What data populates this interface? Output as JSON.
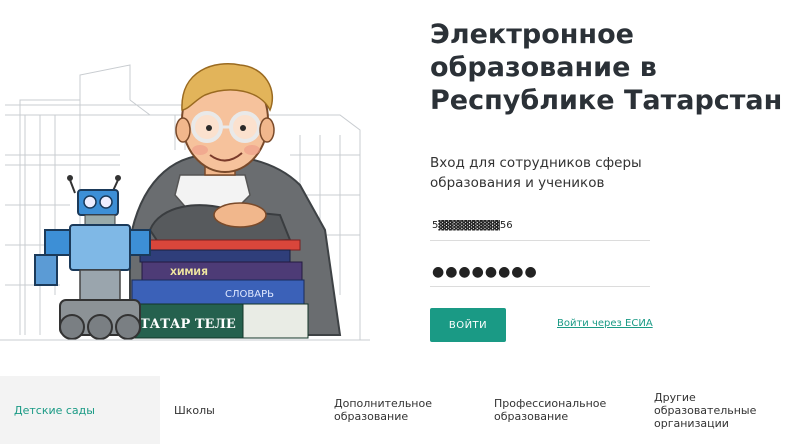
{
  "hero": {
    "title": "Электронное\nобразование в\nРеспублике Татарстан",
    "subtitle": "Вход для сотрудников сферы\nобразования и учеников"
  },
  "illustration": {
    "books": {
      "chemistry": "ХИМИЯ",
      "dictionary": "СЛОВАРЬ",
      "tatar": "ТАТАР ТЕЛЕ"
    }
  },
  "login": {
    "login_value": "5▓▓▓▓▓▓▓▓56",
    "password_value": "●●●●●●●●",
    "submit_label": "ВОЙТИ",
    "esia_link": "Войти через ЕСИА"
  },
  "categories": [
    {
      "label": "Детские сады",
      "active": true
    },
    {
      "label": "Школы",
      "active": false
    },
    {
      "label": "Дополнительное\nобразование",
      "active": false
    },
    {
      "label": "Профессиональное\nобразование",
      "active": false
    },
    {
      "label": "Другие\nобразовательные\nорганизации",
      "active": false
    }
  ],
  "colors": {
    "accent": "#1a9a85",
    "title": "#2b3137"
  }
}
